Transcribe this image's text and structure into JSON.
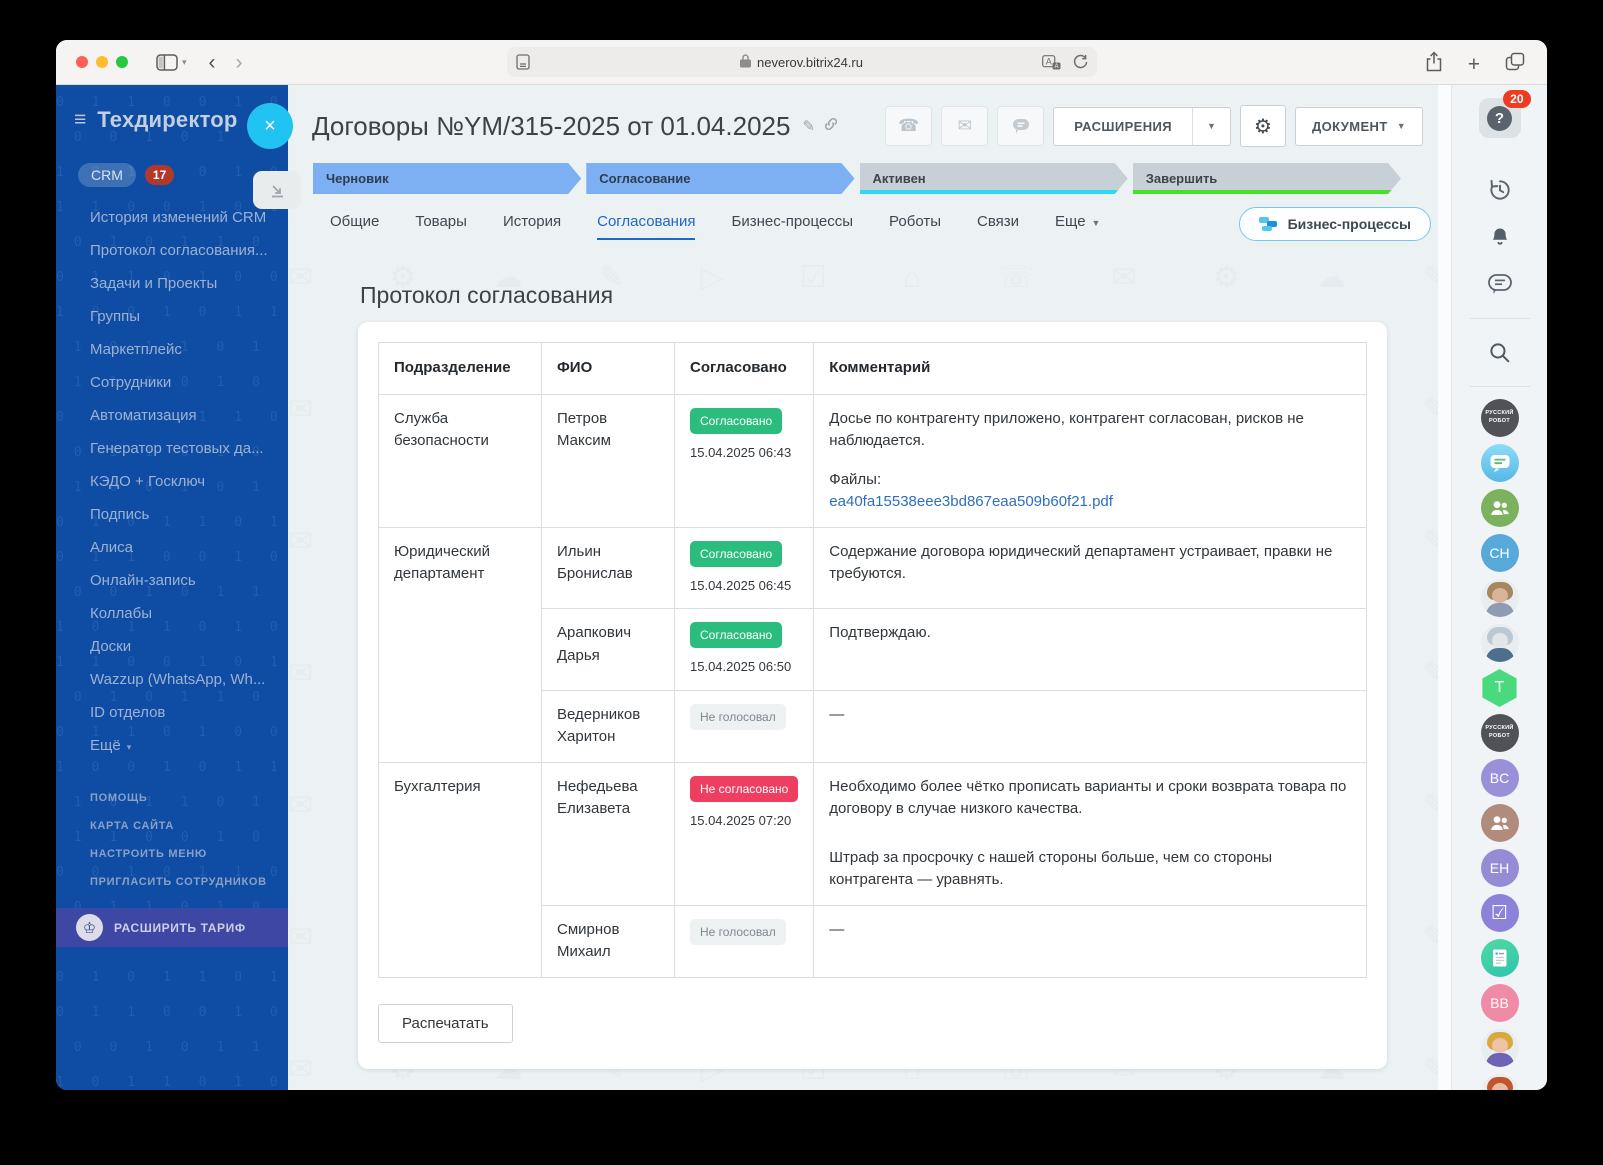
{
  "browser": {
    "url": "neverov.bitrix24.ru"
  },
  "sidebar": {
    "title": "Техдиректор",
    "crm_label": "CRM",
    "crm_badge": "17",
    "items": [
      {
        "label": "История изменений CRM"
      },
      {
        "label": "Протокол согласования..."
      },
      {
        "label": "Задачи и Проекты"
      },
      {
        "label": "Группы"
      },
      {
        "label": "Маркетплейс"
      },
      {
        "label": "Сотрудники"
      },
      {
        "label": "Автоматизация"
      },
      {
        "label": "Генератор тестовых да..."
      },
      {
        "label": "КЭДО + Госключ"
      },
      {
        "label": "Подпись"
      },
      {
        "label": "Алиса"
      },
      {
        "label": "Онлайн-запись"
      },
      {
        "label": "Коллабы"
      },
      {
        "label": "Доски"
      },
      {
        "label": "Wazzup (WhatsApp, Wh..."
      },
      {
        "label": "ID отделов"
      },
      {
        "label": "Ещё",
        "caret": true
      }
    ],
    "footer_items": [
      "ПОМОЩЬ",
      "КАРТА САЙТА",
      "НАСТРОИТЬ МЕНЮ",
      "ПРИГЛАСИТЬ СОТРУДНИКОВ"
    ],
    "upgrade_label": "РАСШИРИТЬ ТАРИФ",
    "binary_row": "0 1 1 0 0 1 0 1 1 0 1 0 0 1 1 0 0 1 0 0 1 1 0 1 "
  },
  "header": {
    "title": "Договоры №YM/315-2025 от 01.04.2025",
    "extensions_label": "РАСШИРЕНИЯ",
    "document_label": "ДОКУМЕНТ"
  },
  "stages": [
    {
      "label": "Черновик",
      "style": "blue"
    },
    {
      "label": "Согласование",
      "style": "blue"
    },
    {
      "label": "Активен",
      "style": "gray",
      "underline": "#2ed9f6"
    },
    {
      "label": "Завершить",
      "style": "gray",
      "underline": "#43e12b"
    }
  ],
  "tabs": [
    {
      "label": "Общие"
    },
    {
      "label": "Товары"
    },
    {
      "label": "История"
    },
    {
      "label": "Согласования",
      "active": true
    },
    {
      "label": "Бизнес-процессы"
    },
    {
      "label": "Роботы"
    },
    {
      "label": "Связи"
    },
    {
      "label": "Еще",
      "caret": true
    }
  ],
  "bp_button_label": "Бизнес-процессы",
  "protocol": {
    "heading": "Протокол согласования",
    "columns": [
      "Подразделение",
      "ФИО",
      "Согласовано",
      "Комментарий"
    ],
    "groups": [
      {
        "department": "Служба безопасности",
        "members": [
          {
            "name": "Петров Максим",
            "status": "approved",
            "status_label": "Согласовано",
            "datetime": "15.04.2025 06:43",
            "comment": [
              "Досье по контрагенту приложено, контрагент согласован, рисков не наблюдается."
            ],
            "files_label": "Файлы:",
            "file_name": "ea40fa15538eee3bd867eaa509b60f21.pdf"
          }
        ]
      },
      {
        "department": "Юридический департамент",
        "members": [
          {
            "name": "Ильин Бронислав",
            "status": "approved",
            "status_label": "Согласовано",
            "datetime": "15.04.2025 06:45",
            "comment": [
              "Содержание договора юридический департамент устраивает, правки не требуются."
            ]
          },
          {
            "name": "Арапкович Дарья",
            "status": "approved",
            "status_label": "Согласовано",
            "datetime": "15.04.2025 06:50",
            "comment": [
              "Подтверждаю."
            ]
          },
          {
            "name": "Ведерников Харитон",
            "status": "none",
            "status_label": "Не голосовал",
            "comment": [
              "—"
            ]
          }
        ]
      },
      {
        "department": "Бухгалтерия",
        "members": [
          {
            "name": "Нефедьева Елизавета",
            "status": "rejected",
            "status_label": "Не согласовано",
            "datetime": "15.04.2025 07:20",
            "comment": [
              "Необходимо более чётко прописать варианты и сроки возврата товара по договору в случае низкого качества.",
              "Штраф за просрочку с нашей стороны больше, чем со стороны контрагента — уравнять."
            ]
          },
          {
            "name": "Смирнов Михаил",
            "status": "none",
            "status_label": "Не голосовал",
            "comment": [
              "—"
            ]
          }
        ]
      }
    ],
    "print_label": "Распечатать"
  },
  "rail": {
    "help_badge": "20",
    "items": [
      {
        "kind": "icon",
        "icon": "history",
        "name": "history-icon"
      },
      {
        "kind": "icon",
        "icon": "bell",
        "name": "notifications-icon"
      },
      {
        "kind": "icon",
        "icon": "chat",
        "name": "messenger-icon"
      },
      {
        "kind": "divider"
      },
      {
        "kind": "icon",
        "icon": "search",
        "name": "search-icon"
      },
      {
        "kind": "divider"
      },
      {
        "kind": "robot",
        "label": "РУССКИЙ РОБОТ",
        "bg": "#515158"
      },
      {
        "kind": "bubble",
        "bg": "#55b8e8"
      },
      {
        "kind": "people",
        "bg": "#7cb25d"
      },
      {
        "kind": "initials",
        "label": "CH",
        "bg": "#57a9d9"
      },
      {
        "kind": "photo",
        "hair": "#a8865e",
        "skin": "#d9b49a",
        "torso": "#8d9bb3"
      },
      {
        "kind": "photo",
        "hair": "#bcc9d4",
        "skin": "#e3e6e9",
        "torso": "#4e6e8e"
      },
      {
        "kind": "hex",
        "label": "T",
        "bg": "#49d97f"
      },
      {
        "kind": "robot",
        "label": "РУССКИЙ РОБОТ",
        "bg": "#515158"
      },
      {
        "kind": "initials",
        "label": "BC",
        "bg": "#9a90d9"
      },
      {
        "kind": "people",
        "bg": "#b18b7b"
      },
      {
        "kind": "initials",
        "label": "EH",
        "bg": "#968bd5"
      },
      {
        "kind": "check",
        "bg": "#8d82d9"
      },
      {
        "kind": "doc",
        "bg": "#43cf8e"
      },
      {
        "kind": "initials",
        "label": "BB",
        "bg": "#ef8ba4"
      },
      {
        "kind": "photo",
        "hair": "#d9a93f",
        "skin": "#ecc3a6",
        "torso": "#6f63b5"
      },
      {
        "kind": "photo",
        "hair": "#c2542e",
        "skin": "#e7bda4",
        "torso": "#86aac4"
      }
    ]
  },
  "decor": {
    "doodle_row": "✉ ⚙ ☁ ✎ ▷ ☑ ⌂ ☏ ✉ ⚙ ☁ ✎ ▷ ☑ ⌂ ☏ ✉ ⚙ ☁ ✎ ▷ ☑ "
  },
  "colors": {
    "sidebar_blue": "#0e4da3",
    "accent_blue": "#1e66c8",
    "stage_blue": "#7db0f3",
    "approved_green": "#2abd7d",
    "rejected_red": "#ef3f60",
    "close_cyan": "#21c3f2"
  }
}
